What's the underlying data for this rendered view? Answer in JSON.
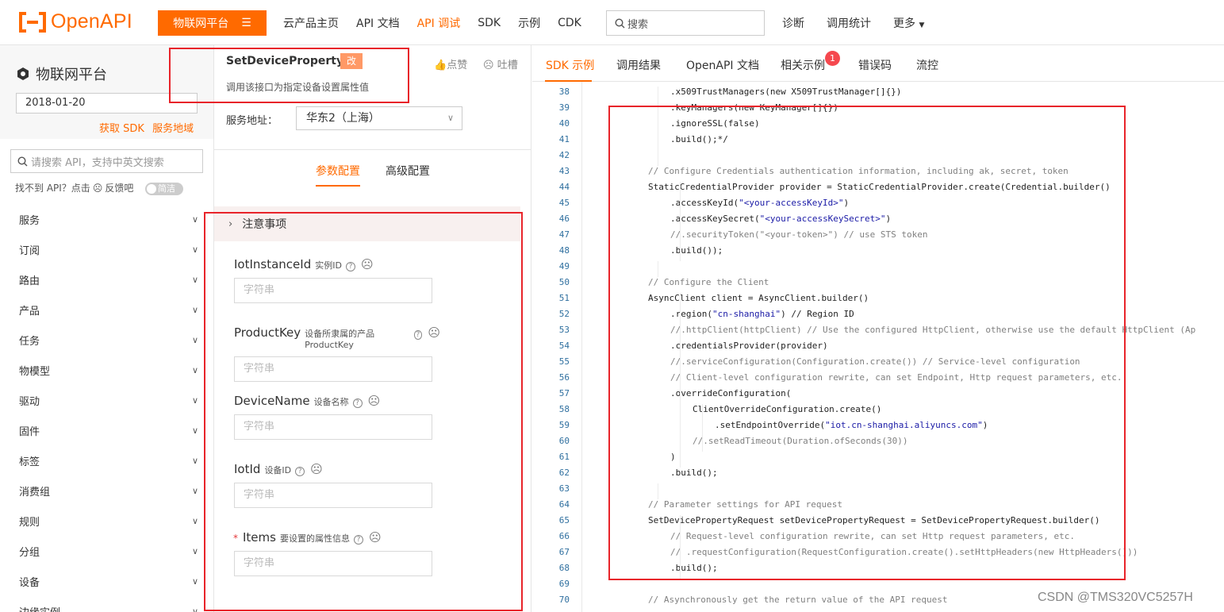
{
  "topbar": {
    "logo_text": "OpenAPI",
    "platform_button": "物联网平台",
    "nav": [
      "云产品主页",
      "API 文档",
      "API 调试",
      "SDK",
      "示例",
      "CDK"
    ],
    "active_nav": 2,
    "search_placeholder": "搜索",
    "right_nav": [
      "诊断",
      "调用统计",
      "更多"
    ]
  },
  "sidebar": {
    "title": "物联网平台",
    "version": "2018-01-20",
    "link_sdk": "获取 SDK",
    "link_region": "服务地域",
    "search_placeholder": "请搜索 API，支持中英文搜索",
    "feedback": "找不到 API？点击",
    "feedback_link": "反馈吧",
    "toggle_label": "简洁",
    "menu": [
      "服务",
      "订阅",
      "路由",
      "产品",
      "任务",
      "物模型",
      "驱动",
      "固件",
      "标签",
      "消费组",
      "规则",
      "分组",
      "设备",
      "边缘实例"
    ]
  },
  "middle": {
    "api_name": "SetDeviceProperty",
    "badge": "改",
    "like": "点赞",
    "complain": "吐槽",
    "description": "调用该接口为指定设备设置属性值",
    "service_label": "服务地址：",
    "service_value": "华东2（上海）",
    "tabs": [
      "参数配置",
      "高级配置"
    ],
    "notice": "注意事项",
    "fields": [
      {
        "name": "IotInstanceId",
        "desc": "实例ID",
        "placeholder": "字符串",
        "required": false
      },
      {
        "name": "ProductKey",
        "desc": "设备所隶属的产品ProductKey",
        "placeholder": "字符串",
        "required": false
      },
      {
        "name": "DeviceName",
        "desc": "设备名称",
        "placeholder": "字符串",
        "required": false
      },
      {
        "name": "IotId",
        "desc": "设备ID",
        "placeholder": "字符串",
        "required": false
      },
      {
        "name": "Items",
        "desc": "要设置的属性信息",
        "placeholder": "字符串",
        "required": true
      }
    ]
  },
  "right": {
    "tabs": [
      "SDK 示例",
      "调用结果",
      "OpenAPI 文档",
      "相关示例",
      "错误码",
      "流控"
    ],
    "badge_count": "1",
    "code_start_line": 38,
    "code_lines": [
      ".x509TrustManagers(new X509TrustManager[]{})",
      ".keyManagers(new KeyManager[]{})",
      ".ignoreSSL(false)",
      ".build();*/",
      "",
      "// Configure Credentials authentication information, including ak, secret, token",
      "StaticCredentialProvider provider = StaticCredentialProvider.create(Credential.builder()",
      ".accessKeyId(\"<your-accessKeyId>\")",
      ".accessKeySecret(\"<your-accessKeySecret>\")",
      "//.securityToken(\"<your-token>\") // use STS token",
      ".build());",
      "",
      "// Configure the Client",
      "AsyncClient client = AsyncClient.builder()",
      ".region(\"cn-shanghai\") // Region ID",
      "//.httpClient(httpClient) // Use the configured HttpClient, otherwise use the default HttpClient (Ap",
      ".credentialsProvider(provider)",
      "//.serviceConfiguration(Configuration.create()) // Service-level configuration",
      "// Client-level configuration rewrite, can set Endpoint, Http request parameters, etc.",
      ".overrideConfiguration(",
      "ClientOverrideConfiguration.create()",
      ".setEndpointOverride(\"iot.cn-shanghai.aliyuncs.com\")",
      "//.setReadTimeout(Duration.ofSeconds(30))",
      ")",
      ".build();",
      "",
      "// Parameter settings for API request",
      "SetDevicePropertyRequest setDevicePropertyRequest = SetDevicePropertyRequest.builder()",
      "// Request-level configuration rewrite, can set Http request parameters, etc.",
      "// .requestConfiguration(RequestConfiguration.create().setHttpHeaders(new HttpHeaders()))",
      ".build();",
      "",
      "// Asynchronously get the return value of the API request"
    ],
    "code_indents": [
      2,
      2,
      2,
      2,
      0,
      1,
      1,
      2,
      2,
      2,
      2,
      0,
      1,
      1,
      2,
      2,
      2,
      2,
      2,
      2,
      3,
      4,
      3,
      2,
      2,
      0,
      1,
      1,
      2,
      2,
      2,
      0,
      1
    ]
  },
  "watermark": "CSDN @TMS320VC5257H",
  "colors": {
    "accent": "#ff6a00",
    "annotation": "#e8242a",
    "badge": "#f5484e"
  }
}
